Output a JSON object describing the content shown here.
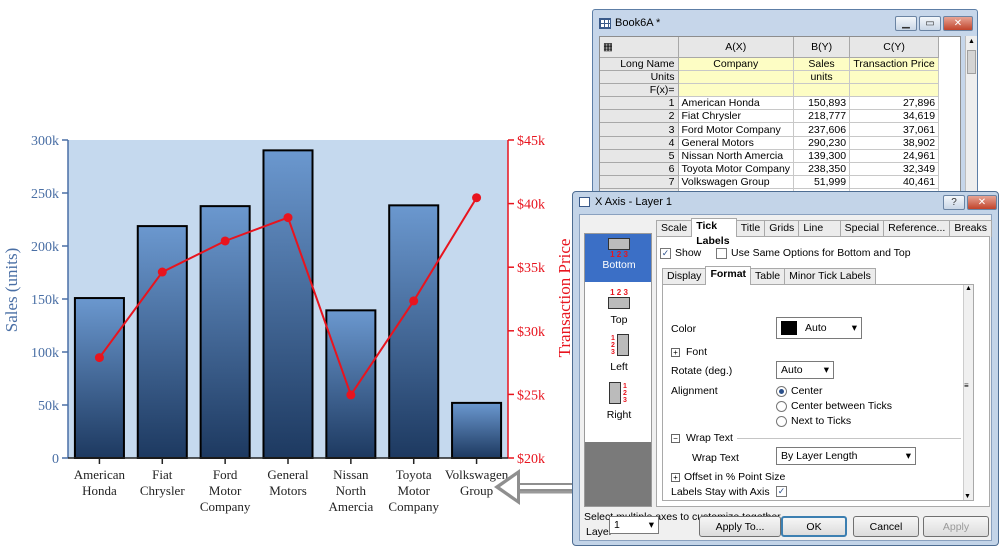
{
  "chart_data": {
    "type": "bar",
    "categories": [
      "American\nHonda",
      "Fiat\nChrysler",
      "Ford\nMotor\nCompany",
      "General\nMotors",
      "Nissan\nNorth\nAmercia",
      "Toyota\nMotor\nCompany",
      "Volkswagen\nGroup"
    ],
    "series": [
      {
        "name": "Sales (units)",
        "values": [
          150893,
          218777,
          237606,
          290230,
          139300,
          238350,
          51999
        ],
        "axis": "left",
        "kind": "bar",
        "color": "#4a78b0"
      },
      {
        "name": "Transaction Price",
        "values": [
          27896,
          34619,
          37061,
          38902,
          24961,
          32349,
          40461
        ],
        "axis": "right",
        "kind": "line",
        "color": "#e8141e"
      }
    ],
    "ylabel": "Sales (units)",
    "y2label": "Transaction Price",
    "ylim": [
      0,
      300000
    ],
    "y2lim": [
      20000,
      45000
    ],
    "yticks": [
      "0",
      "50k",
      "100k",
      "150k",
      "200k",
      "250k",
      "300k"
    ],
    "y2ticks": [
      "$20k",
      "$25k",
      "$30k",
      "$35k",
      "$40k",
      "$45k"
    ],
    "plot_bg": "#c5d9ee",
    "left_axis_color": "#4a6fa5",
    "right_axis_color": "#e8141e"
  },
  "worksheet": {
    "title": "Book6A *",
    "columns": [
      "A(X)",
      "B(Y)",
      "C(Y)"
    ],
    "meta_rows": [
      {
        "label": "Long Name",
        "values": [
          "Company",
          "Sales",
          "Transaction Price"
        ]
      },
      {
        "label": "Units",
        "values": [
          "",
          "units",
          ""
        ]
      },
      {
        "label": "F(x)=",
        "values": [
          "",
          "",
          ""
        ]
      }
    ],
    "rows": [
      {
        "n": "1",
        "company": "American Honda",
        "sales": "150,893",
        "price": "27,896"
      },
      {
        "n": "2",
        "company": "Fiat Chrysler",
        "sales": "218,777",
        "price": "34,619"
      },
      {
        "n": "3",
        "company": "Ford Motor Company",
        "sales": "237,606",
        "price": "37,061"
      },
      {
        "n": "4",
        "company": "General Motors",
        "sales": "290,230",
        "price": "38,902"
      },
      {
        "n": "5",
        "company": "Nissan North Amercia",
        "sales": "139,300",
        "price": "24,961"
      },
      {
        "n": "6",
        "company": "Toyota Motor Company",
        "sales": "238,350",
        "price": "32,349"
      },
      {
        "n": "7",
        "company": "Volkswagen Group",
        "sales": "51,999",
        "price": "40,461"
      }
    ]
  },
  "dialog": {
    "title": "X Axis - Layer 1",
    "help": "?",
    "tabs": [
      "Scale",
      "Tick Labels",
      "Title",
      "Grids",
      "Line and ...",
      "Special Ti...",
      "Reference...",
      "Breaks"
    ],
    "active_tab": "Tick Labels",
    "side": [
      "Bottom",
      "Top",
      "Left",
      "Right"
    ],
    "show_label": "Show",
    "same_options_label": "Use Same Options for Bottom and Top",
    "subtabs": [
      "Display",
      "Format",
      "Table",
      "Minor Tick Labels"
    ],
    "color_label": "Color",
    "color_value": "Auto",
    "font_label": "Font",
    "rotate_label": "Rotate (deg.)",
    "rotate_value": "Auto",
    "alignment_label": "Alignment",
    "align_options": [
      "Center",
      "Center between Ticks",
      "Next to Ticks"
    ],
    "wrap_section": "Wrap Text",
    "wrap_label": "Wrap Text",
    "wrap_value": "By Layer Length",
    "offset_label": "Offset in % Point Size",
    "stay_label": "Labels Stay with Axis",
    "hint": "Select multiple axes to customize together.",
    "layer_label": "Layer",
    "layer_value": "1",
    "buttons": {
      "apply_to": "Apply To...",
      "ok": "OK",
      "cancel": "Cancel",
      "apply": "Apply"
    }
  }
}
